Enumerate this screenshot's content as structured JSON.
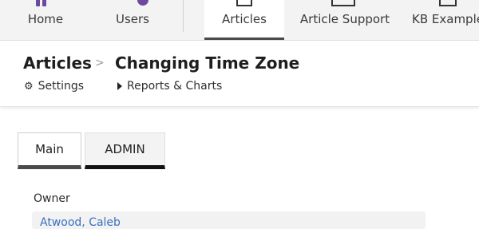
{
  "topnav": {
    "items": [
      {
        "label": "Home",
        "icon": "home-icon",
        "active": false
      },
      {
        "label": "Users",
        "icon": "users-icon",
        "active": false
      },
      {
        "label": "Articles",
        "icon": "articles-icon",
        "active": true
      },
      {
        "label": "Article Support",
        "icon": "article-support-icon",
        "active": false
      },
      {
        "label": "KB Examples",
        "icon": "kb-examples-icon",
        "active": false
      }
    ],
    "accent_color": "#6b4aa0"
  },
  "header": {
    "breadcrumb_root": "Articles",
    "breadcrumb_separator": ">",
    "page_title": "Changing Time Zone",
    "settings_label": "Settings",
    "reports_label": "Reports & Charts"
  },
  "tabs": [
    {
      "label": "Main",
      "active": true
    },
    {
      "label": "ADMIN",
      "active": false
    }
  ],
  "form": {
    "owner_label": "Owner",
    "owner_value": "Atwood, Caleb"
  }
}
